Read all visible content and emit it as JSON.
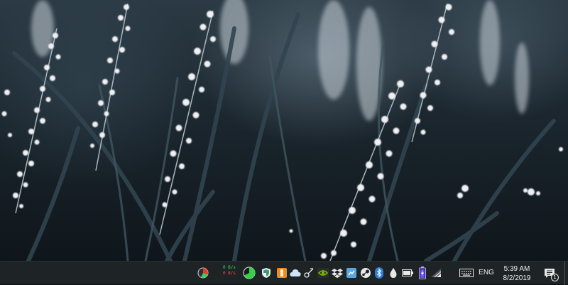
{
  "desktop": {
    "wallpaper": "white-flower-spikes-in-dark-grass",
    "colors": {
      "grass": "#1c2a33",
      "flowers": "#f0f0f2",
      "highlight": "#9fb3c2"
    }
  },
  "taskbar": {
    "background": "#1e2326",
    "tray": {
      "icons": [
        "pie-meter-icon",
        "network-speed-meter",
        "green-pie-icon",
        "shield-icon",
        "orange-app-icon",
        "cloud-icon",
        "network-tool-icon",
        "nvidia-icon",
        "dropbox-icon",
        "screenshot-tool-icon",
        "steam-icon",
        "bluetooth-icon",
        "ink-drop-icon",
        "battery-icon",
        "battery-meter-icon",
        "wifi-icon",
        "keyboard-icon",
        "notification-icon"
      ],
      "network_speed": {
        "upload": "0 B/s",
        "download": "0 B/s",
        "up_color": "#3ddc4a",
        "down_color": "#ff4a4a"
      },
      "language": "ENG",
      "clock": {
        "time": "5:39 AM",
        "date": "8/2/2019"
      },
      "notification_count": "1"
    }
  }
}
